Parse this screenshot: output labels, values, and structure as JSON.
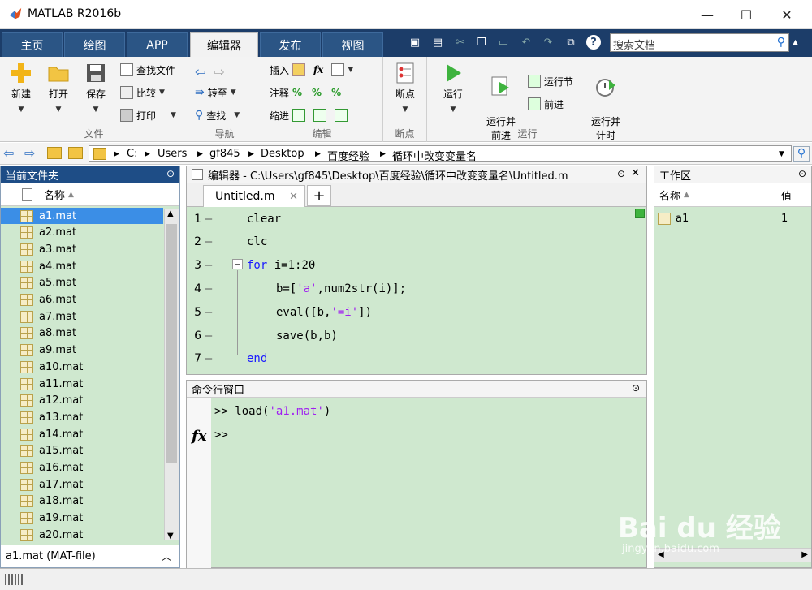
{
  "window": {
    "title": "MATLAB R2016b",
    "minimize": "—",
    "maximize": "☐",
    "close": "✕"
  },
  "tabs": [
    "主页",
    "绘图",
    "APP",
    "编辑器",
    "发布",
    "视图"
  ],
  "search": {
    "placeholder": "搜索文档"
  },
  "ribbon": {
    "file": {
      "label": "文件",
      "new": "新建",
      "open": "打开",
      "save": "保存",
      "find_files": "查找文件",
      "compare": "比较",
      "print": "打印"
    },
    "navigate": {
      "label": "导航",
      "goto": "转至",
      "find": "查找"
    },
    "edit": {
      "label": "编辑",
      "insert": "插入",
      "comment": "注释",
      "indent": "缩进"
    },
    "breakpoints": {
      "label": "断点",
      "breakpoints": "断点"
    },
    "run": {
      "label": "运行",
      "run": "运行",
      "run_advance": "运行并\n前进",
      "run_section": "运行节",
      "advance": "前进",
      "run_time": "运行并\n计时"
    }
  },
  "address": {
    "crumbs": [
      "C:",
      "Users",
      "gf845",
      "Desktop",
      "百度经验",
      "循环中改变变量名"
    ]
  },
  "current_folder": {
    "title": "当前文件夹",
    "column": "名称",
    "files": [
      "a1.mat",
      "a2.mat",
      "a3.mat",
      "a4.mat",
      "a5.mat",
      "a6.mat",
      "a7.mat",
      "a8.mat",
      "a9.mat",
      "a10.mat",
      "a11.mat",
      "a12.mat",
      "a13.mat",
      "a14.mat",
      "a15.mat",
      "a16.mat",
      "a17.mat",
      "a18.mat",
      "a19.mat",
      "a20.mat"
    ],
    "detail": "a1.mat  (MAT-file)"
  },
  "editor": {
    "title": "编辑器 - C:\\Users\\gf845\\Desktop\\百度经验\\循环中改变变量名\\Untitled.m",
    "tab": "Untitled.m",
    "lines": [
      {
        "n": "1",
        "parts": [
          [
            "",
            "clear"
          ]
        ]
      },
      {
        "n": "2",
        "parts": [
          [
            "",
            "clc"
          ]
        ]
      },
      {
        "n": "3",
        "parts": [
          [
            "kw",
            "for"
          ],
          [
            "",
            " i=1:20"
          ]
        ]
      },
      {
        "n": "4",
        "parts": [
          [
            "",
            "b=["
          ],
          [
            "str",
            "'a'"
          ],
          [
            "",
            ",num2str(i)];"
          ]
        ]
      },
      {
        "n": "5",
        "parts": [
          [
            "",
            "eval([b,"
          ],
          [
            "str",
            "'=i'"
          ],
          [
            "",
            "])"
          ]
        ]
      },
      {
        "n": "6",
        "parts": [
          [
            "",
            "save(b,b)"
          ]
        ]
      },
      {
        "n": "7",
        "parts": [
          [
            "kw",
            "end"
          ]
        ]
      }
    ]
  },
  "command": {
    "title": "命令行窗口",
    "prompt": ">>",
    "line1_pre": "load(",
    "line1_str": "'a1.mat'",
    "line1_post": ")",
    "fx": "fx"
  },
  "workspace": {
    "title": "工作区",
    "col_name": "名称",
    "col_value": "值",
    "vars": [
      {
        "name": "a1",
        "value": "1"
      }
    ]
  },
  "watermark": {
    "brand": "Bai du 经验",
    "url": "jingyan.baidu.com"
  }
}
